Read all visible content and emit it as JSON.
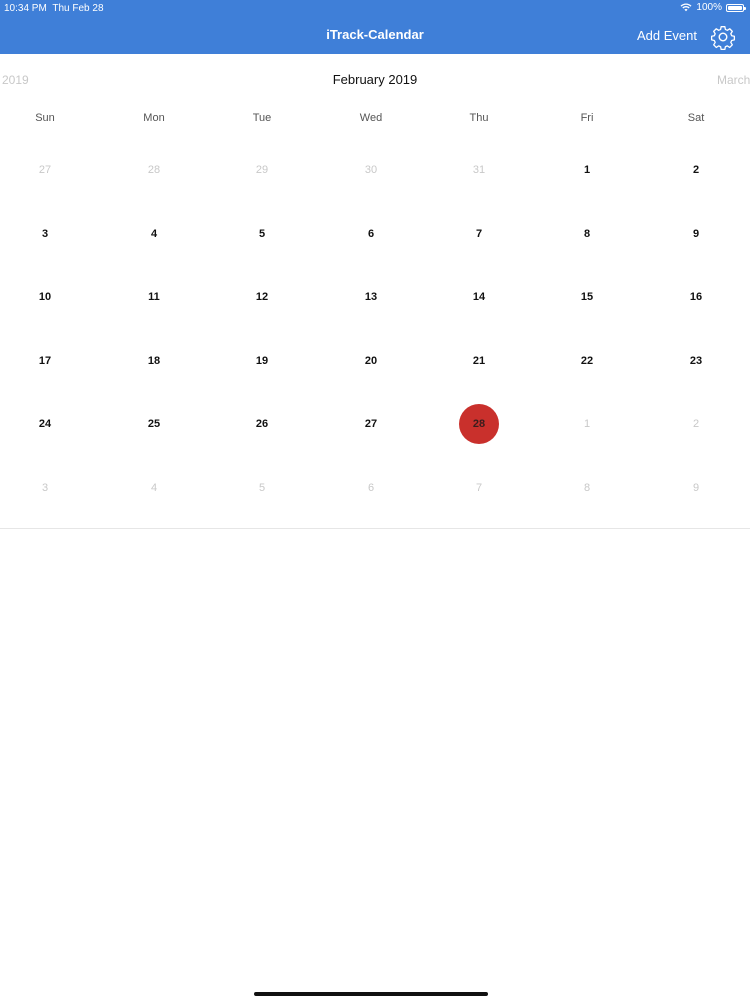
{
  "status": {
    "time": "10:34 PM",
    "date": "Thu Feb 28",
    "battery": "100%",
    "battery_level": 1.0
  },
  "nav": {
    "title": "iTrack-Calendar",
    "add_event": "Add Event",
    "settings_icon": "gear-icon"
  },
  "colors": {
    "header": "#3f7fd8",
    "today": "#c9302c"
  },
  "month": {
    "current": "February 2019",
    "prev": "2019",
    "next": "March"
  },
  "weekdays": [
    "Sun",
    "Mon",
    "Tue",
    "Wed",
    "Thu",
    "Fri",
    "Sat"
  ],
  "weeks": [
    [
      "27",
      "28",
      "29",
      "30",
      "31",
      "1",
      "2"
    ],
    [
      "3",
      "4",
      "5",
      "6",
      "7",
      "8",
      "9"
    ],
    [
      "10",
      "11",
      "12",
      "13",
      "14",
      "15",
      "16"
    ],
    [
      "17",
      "18",
      "19",
      "20",
      "21",
      "22",
      "23"
    ],
    [
      "24",
      "25",
      "26",
      "27",
      "28",
      "1",
      "2"
    ],
    [
      "3",
      "4",
      "5",
      "6",
      "7",
      "8",
      "9"
    ]
  ],
  "selected_day": "28"
}
